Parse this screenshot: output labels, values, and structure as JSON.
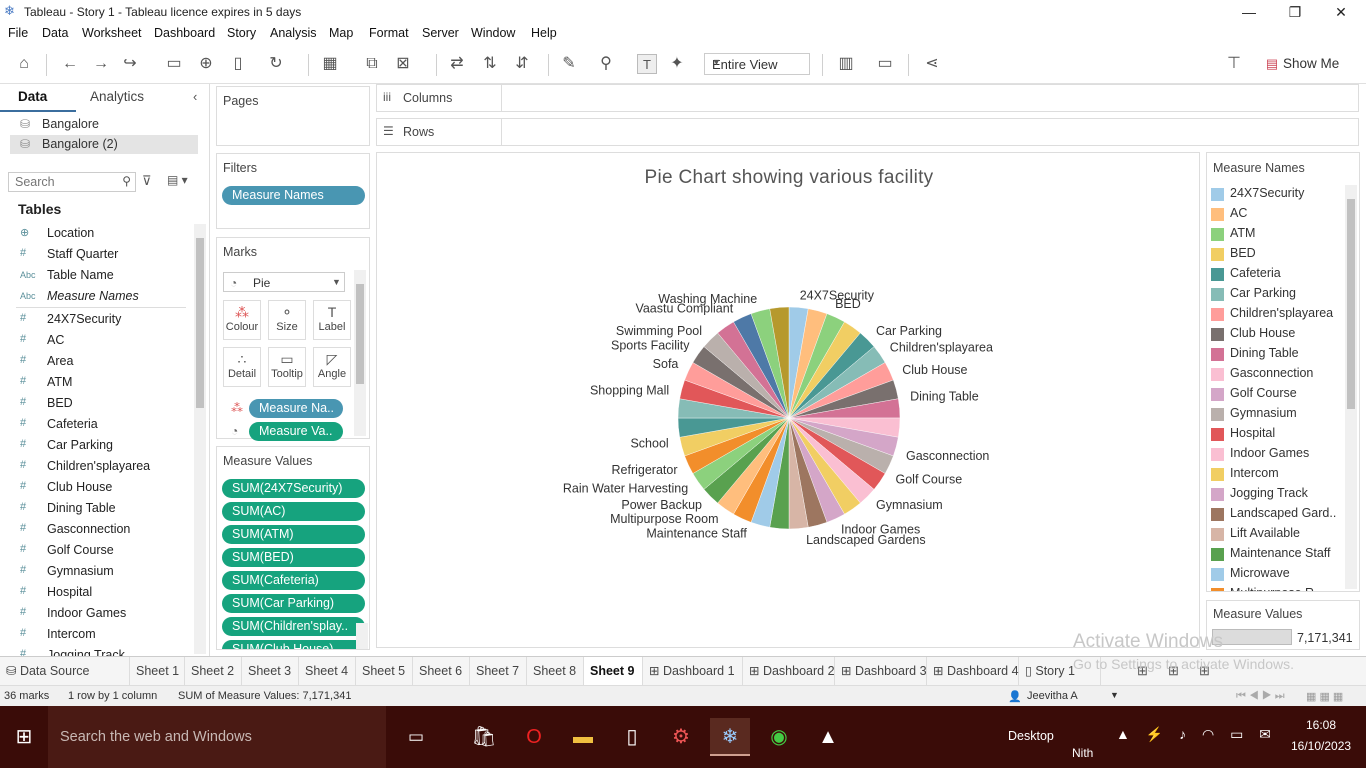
{
  "window": {
    "title": "Tableau - Story 1 - Tableau licence expires in 5 days"
  },
  "menu": [
    "File",
    "Data",
    "Worksheet",
    "Dashboard",
    "Story",
    "Analysis",
    "Map",
    "Format",
    "Server",
    "Window",
    "Help"
  ],
  "toolbar": {
    "view_select": "Entire View",
    "show_me": "Show Me"
  },
  "data_pane": {
    "tab_data": "Data",
    "tab_analytics": "Analytics",
    "sources": [
      "Bangalore",
      "Bangalore (2)"
    ],
    "search_placeholder": "Search",
    "tables_heading": "Tables",
    "fields": [
      {
        "icon": "⊕",
        "name": "Location"
      },
      {
        "icon": "#",
        "name": "Staff Quarter"
      },
      {
        "icon": "Abc",
        "name": "Table Name"
      },
      {
        "icon": "Abc",
        "name": "Measure Names"
      },
      {
        "icon": "#",
        "name": "24X7Security"
      },
      {
        "icon": "#",
        "name": "AC"
      },
      {
        "icon": "#",
        "name": "Area"
      },
      {
        "icon": "#",
        "name": "ATM"
      },
      {
        "icon": "#",
        "name": "BED"
      },
      {
        "icon": "#",
        "name": "Cafeteria"
      },
      {
        "icon": "#",
        "name": "Car Parking"
      },
      {
        "icon": "#",
        "name": "Children'splayarea"
      },
      {
        "icon": "#",
        "name": "Club House"
      },
      {
        "icon": "#",
        "name": "Dining Table"
      },
      {
        "icon": "#",
        "name": "Gasconnection"
      },
      {
        "icon": "#",
        "name": "Golf Course"
      },
      {
        "icon": "#",
        "name": "Gymnasium"
      },
      {
        "icon": "#",
        "name": "Hospital"
      },
      {
        "icon": "#",
        "name": "Indoor Games"
      },
      {
        "icon": "#",
        "name": "Intercom"
      },
      {
        "icon": "#",
        "name": "Jogging Track"
      }
    ]
  },
  "shelves": {
    "pages": "Pages",
    "filters": "Filters",
    "filter_pill": "Measure Names",
    "marks": "Marks",
    "mark_type": "Pie",
    "mark_buttons": [
      "Colour",
      "Size",
      "Label",
      "Detail",
      "Tooltip",
      "Angle"
    ],
    "mark_pills": [
      "Measure Na..",
      "Measure Va.."
    ],
    "measure_values": "Measure Values",
    "measure_pills": [
      "SUM(24X7Security)",
      "SUM(AC)",
      "SUM(ATM)",
      "SUM(BED)",
      "SUM(Cafeteria)",
      "SUM(Car Parking)",
      "SUM(Children'splay..",
      "SUM(Club House)"
    ],
    "columns": "Columns",
    "rows": "Rows"
  },
  "legend": {
    "title": "Measure Names",
    "items": [
      {
        "name": "24X7Security",
        "color": "#a0cbe8"
      },
      {
        "name": "AC",
        "color": "#ffbe7d"
      },
      {
        "name": "ATM",
        "color": "#8cd17d"
      },
      {
        "name": "BED",
        "color": "#f1ce63"
      },
      {
        "name": "Cafeteria",
        "color": "#499894"
      },
      {
        "name": "Car Parking",
        "color": "#86bcb6"
      },
      {
        "name": "Children'splayarea",
        "color": "#ff9d9a"
      },
      {
        "name": "Club House",
        "color": "#79706e"
      },
      {
        "name": "Dining Table",
        "color": "#d37295"
      },
      {
        "name": "Gasconnection",
        "color": "#fabfd2"
      },
      {
        "name": "Golf Course",
        "color": "#d4a6c8"
      },
      {
        "name": "Gymnasium",
        "color": "#bab0ac"
      },
      {
        "name": "Hospital",
        "color": "#e15759"
      },
      {
        "name": "Indoor Games",
        "color": "#fabfd2"
      },
      {
        "name": "Intercom",
        "color": "#f1ce63"
      },
      {
        "name": "Jogging Track",
        "color": "#d4a6c8"
      },
      {
        "name": "Landscaped Gard..",
        "color": "#9d7660"
      },
      {
        "name": "Lift Available",
        "color": "#d7b5a6"
      },
      {
        "name": "Maintenance Staff",
        "color": "#59a14f"
      },
      {
        "name": "Microwave",
        "color": "#a0cbe8"
      },
      {
        "name": "Multipurpose R..",
        "color": "#f28e2b"
      }
    ],
    "measure_values_title": "Measure Values",
    "measure_values_total": "7,171,341"
  },
  "chart_data": {
    "type": "pie",
    "title": "Pie Chart showing various facility",
    "slice_count": 36,
    "colors": [
      "#a0cbe8",
      "#ffbe7d",
      "#8cd17d",
      "#f1ce63",
      "#499894",
      "#86bcb6",
      "#ff9d9a",
      "#79706e",
      "#d37295",
      "#fabfd2",
      "#d4a6c8",
      "#bab0ac",
      "#e15759",
      "#fabfd2",
      "#f1ce63",
      "#d4a6c8",
      "#9d7660",
      "#d7b5a6",
      "#59a14f",
      "#a0cbe8",
      "#f28e2b",
      "#ffbe7d",
      "#59a14f",
      "#8cd17d",
      "#f28e2b",
      "#f1ce63",
      "#499894",
      "#86bcb6",
      "#e15759",
      "#ff9d9a",
      "#79706e",
      "#bab0ac",
      "#d37295",
      "#4e79a7",
      "#8cd17d",
      "#b6992d"
    ],
    "labels": [
      {
        "text": "24X7Security",
        "angle": 5
      },
      {
        "text": "BED",
        "angle": 22
      },
      {
        "text": "Car Parking",
        "angle": 45
      },
      {
        "text": "Children'splayarea",
        "angle": 55
      },
      {
        "text": "Club House",
        "angle": 67
      },
      {
        "text": "Dining Table",
        "angle": 80
      },
      {
        "text": "Gasconnection",
        "angle": 108
      },
      {
        "text": "Golf Course",
        "angle": 120
      },
      {
        "text": "Gymnasium",
        "angle": 135
      },
      {
        "text": "Indoor Games",
        "angle": 155
      },
      {
        "text": "Landscaped Gardens",
        "angle": 172
      },
      {
        "text": "Maintenance Staff",
        "angle": 200
      },
      {
        "text": "Multipurpose Room",
        "angle": 215
      },
      {
        "text": "Power Backup",
        "angle": 225
      },
      {
        "text": "Rain Water Harvesting",
        "angle": 235
      },
      {
        "text": "Refrigerator",
        "angle": 245
      },
      {
        "text": "School",
        "angle": 258
      },
      {
        "text": "Shopping Mall",
        "angle": 283
      },
      {
        "text": "Sofa",
        "angle": 296
      },
      {
        "text": "Sports Facility",
        "angle": 306
      },
      {
        "text": "Swimming Pool",
        "angle": 315
      },
      {
        "text": "Vaastu Compliant",
        "angle": 333
      },
      {
        "text": "Washing Machine",
        "angle": 345
      }
    ]
  },
  "sheet_tabs": [
    "Data Source",
    "Sheet 1",
    "Sheet 2",
    "Sheet 3",
    "Sheet 4",
    "Sheet 5",
    "Sheet 6",
    "Sheet 7",
    "Sheet 8",
    "Sheet 9",
    "Dashboard 1",
    "Dashboard 2",
    "Dashboard 3",
    "Dashboard 4",
    "Story 1"
  ],
  "active_tab": "Sheet 9",
  "status": {
    "marks": "36 marks",
    "rows": "1 row  by  1 column",
    "sum": "SUM of Measure Values: 7,171,341",
    "user": "Jeevitha A"
  },
  "watermark": {
    "line1": "Activate Windows",
    "line2": "Go to Settings to activate Windows."
  },
  "taskbar": {
    "search_placeholder": "Search the web and Windows",
    "desktop": "Desktop",
    "nith": "Nith",
    "time": "16:08",
    "date": "16/10/2023"
  }
}
